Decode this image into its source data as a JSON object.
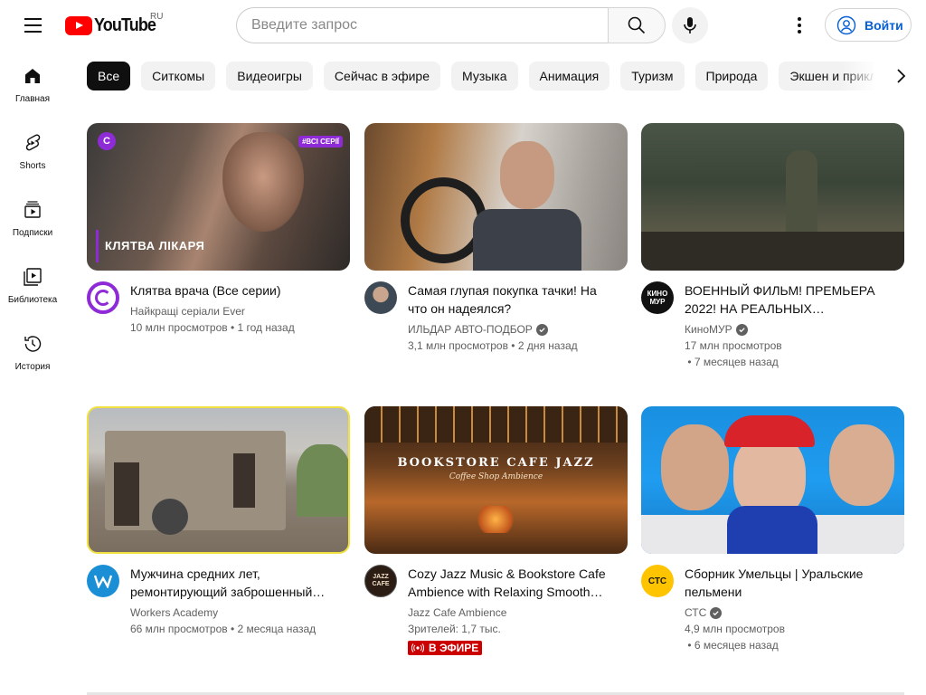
{
  "header": {
    "logo_text": "YouTube",
    "country": "RU",
    "search_placeholder": "Введите запрос",
    "signin_label": "Войти"
  },
  "sidebar": {
    "items": [
      {
        "label": "Главная",
        "icon": "home-icon"
      },
      {
        "label": "Shorts",
        "icon": "shorts-icon"
      },
      {
        "label": "Подписки",
        "icon": "subscriptions-icon"
      },
      {
        "label": "Библиотека",
        "icon": "library-icon"
      },
      {
        "label": "История",
        "icon": "history-icon"
      }
    ]
  },
  "chips": [
    "Все",
    "Ситкомы",
    "Видеоигры",
    "Сейчас в эфире",
    "Музыка",
    "Анимация",
    "Туризм",
    "Природа",
    "Экшен и приключения"
  ],
  "videos": [
    {
      "title": "Клятва врача (Все серии)",
      "channel": "Найкращі серіали Ever",
      "views": "10 млн просмотров",
      "age": "1 год назад",
      "thumb_overlay": "КЛЯТВА ЛІКАРЯ",
      "thumb_tag": "#ВСІ СЕРІЇ"
    },
    {
      "title": "Самая глупая покупка тачки! На что он надеялся?",
      "channel": "ИЛЬДАР АВТО-ПОДБОР",
      "views": "3,1 млн просмотров",
      "age": "2 дня назад"
    },
    {
      "title": "ВОЕННЫЙ ФИЛЬМ! ПРЕМЬЕРА 2022! НА РЕАЛЬНЫХ…",
      "channel": "КиноМУР",
      "views": "17 млн просмотров",
      "age": "7 месяцев назад",
      "avatar_text": "КИНО МУР"
    },
    {
      "title": "Мужчина средних лет, ремонтирующий заброшенный…",
      "channel": "Workers Academy",
      "views": "66 млн просмотров",
      "age": "2 месяца назад"
    },
    {
      "title": "Cozy Jazz Music & Bookstore Cafe Ambience with Relaxing Smooth…",
      "channel": "Jazz Cafe Ambience",
      "views": "Зрителей: 1,7 тыс.",
      "live_label": "В ЭФИРЕ",
      "thumb_overlay": "BOOKSTORE CAFE JAZZ",
      "thumb_sub": "Coffee Shop Ambience",
      "avatar_text": "JAZZ CAFE"
    },
    {
      "title": "Сборник Умельцы | Уральские пельмени",
      "channel": "СТС",
      "views": "4,9 млн просмотров",
      "age": "6 месяцев назад",
      "avatar_text": "СТС"
    }
  ],
  "colors": {
    "brand_red": "#ff0000",
    "link_blue": "#065fd4",
    "live_red": "#cc0000"
  }
}
